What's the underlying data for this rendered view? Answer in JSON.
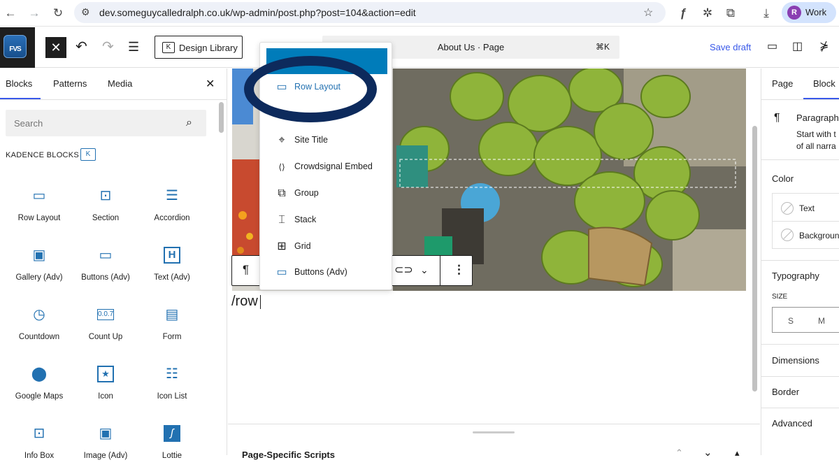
{
  "browser": {
    "url": "dev.someguycalledralph.co.uk/wp-admin/post.php?post=104&action=edit",
    "profile_initial": "R",
    "profile_label": "Work"
  },
  "header": {
    "design_library_label": "Design Library",
    "command_title": "About Us · Page",
    "command_shortcut": "⌘K",
    "save_draft_label": "Save draft"
  },
  "inserter": {
    "tabs": [
      "Blocks",
      "Patterns",
      "Media"
    ],
    "search_placeholder": "Search",
    "section_label": "KADENCE BLOCKS",
    "blocks": [
      {
        "label": "Row Layout",
        "icon": "row-layout-icon"
      },
      {
        "label": "Section",
        "icon": "section-icon"
      },
      {
        "label": "Accordion",
        "icon": "accordion-icon"
      },
      {
        "label": "Gallery (Adv)",
        "icon": "gallery-icon"
      },
      {
        "label": "Buttons (Adv)",
        "icon": "buttons-icon"
      },
      {
        "label": "Text (Adv)",
        "icon": "text-icon"
      },
      {
        "label": "Countdown",
        "icon": "countdown-icon"
      },
      {
        "label": "Count Up",
        "icon": "count-up-icon"
      },
      {
        "label": "Form",
        "icon": "form-icon"
      },
      {
        "label": "Google Maps",
        "icon": "map-pin-icon"
      },
      {
        "label": "Icon",
        "icon": "icon-block-icon"
      },
      {
        "label": "Icon List",
        "icon": "icon-list-icon"
      },
      {
        "label": "Info Box",
        "icon": "info-box-icon"
      },
      {
        "label": "Image (Adv)",
        "icon": "image-icon"
      },
      {
        "label": "Lottie",
        "icon": "lottie-icon"
      }
    ]
  },
  "canvas": {
    "typed_text": "/row",
    "meta_box_title": "Page-Specific Scripts"
  },
  "autocomplete": {
    "items": [
      {
        "label": "Row Layout",
        "icon": "row-layout-icon"
      },
      {
        "label": "Site Title",
        "icon": "site-title-icon"
      },
      {
        "label": "Crowdsignal Embed",
        "icon": "embed-icon"
      },
      {
        "label": "Group",
        "icon": "group-icon"
      },
      {
        "label": "Stack",
        "icon": "stack-icon"
      },
      {
        "label": "Grid",
        "icon": "grid-icon"
      },
      {
        "label": "Buttons (Adv)",
        "icon": "buttons-icon"
      }
    ]
  },
  "settings": {
    "tabs": [
      "Page",
      "Block"
    ],
    "block_name": "Paragraph",
    "block_desc_1": "Start with t",
    "block_desc_2": "of all narra",
    "color_heading": "Color",
    "color_text": "Text",
    "color_background": "Backgroun",
    "typography_heading": "Typography",
    "size_label": "SIZE",
    "size_s": "S",
    "size_m": "M",
    "dimensions_heading": "Dimensions",
    "border_heading": "Border",
    "advanced_heading": "Advanced"
  },
  "colors": {
    "accent": "#3858e9",
    "kadence_blue": "#2271b1",
    "highlight": "#007cba",
    "annotation": "#0d2a5c"
  }
}
